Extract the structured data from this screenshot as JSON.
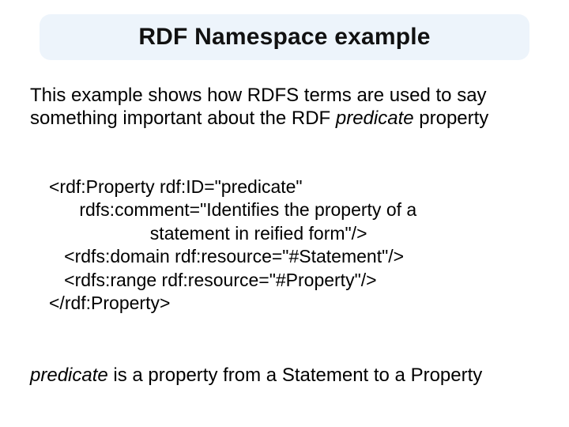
{
  "title": "RDF Namespace example",
  "intro": {
    "part1": "This example shows how RDFS terms are used to say something important about the RDF ",
    "italic": "predicate",
    "part2": " property"
  },
  "code": {
    "l1": "<rdf:Property rdf:ID=\"predicate\"",
    "l2": "      rdfs:comment=\"Identifies the property of a",
    "l3": "                    statement in reified form\"/>",
    "l4": "   <rdfs:domain rdf:resource=\"#Statement\"/>",
    "l5": "   <rdfs:range rdf:resource=\"#Property\"/>",
    "l6": "</rdf:Property>"
  },
  "footer": {
    "italic": "predicate",
    "rest": " is a property from a Statement to a Property"
  }
}
